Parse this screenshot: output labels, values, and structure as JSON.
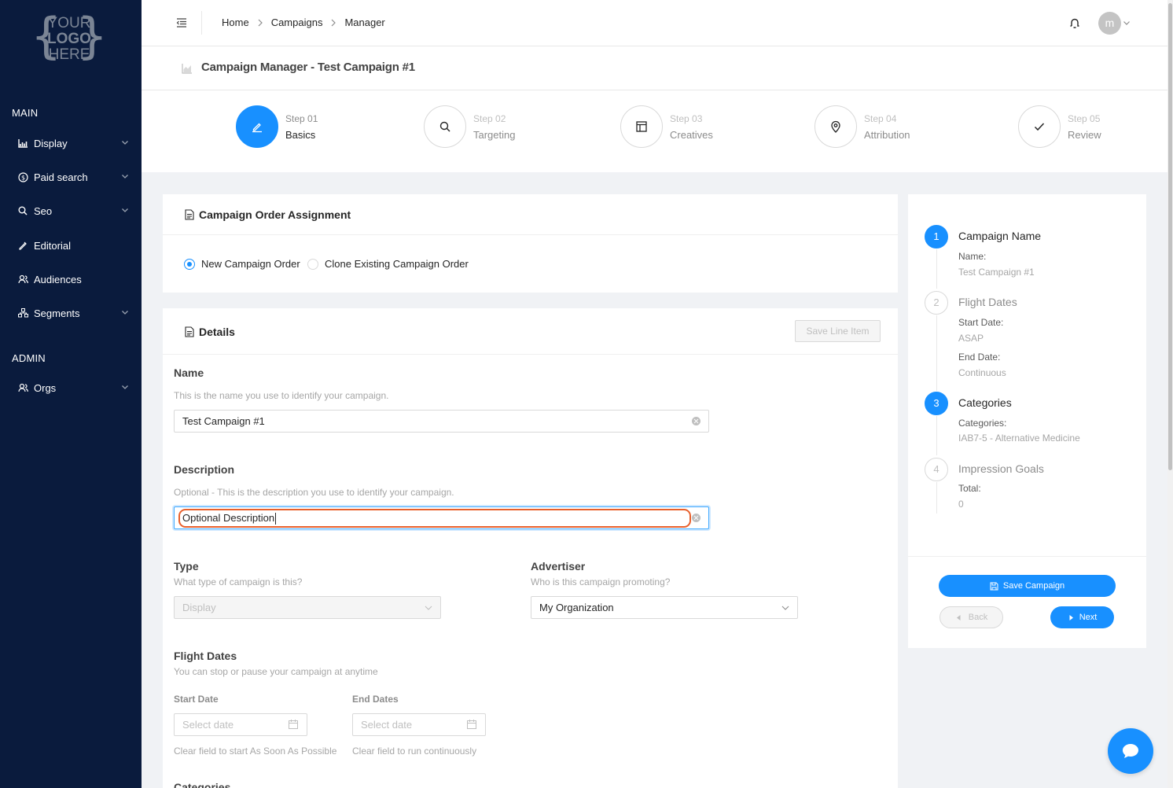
{
  "logo": {
    "line1": "YOUR",
    "line2": "LOGO",
    "line3": "HERE"
  },
  "sidebar": {
    "main_title": "MAIN",
    "admin_title": "ADMIN",
    "items": [
      {
        "label": "Display",
        "icon": "chart-icon",
        "has_children": true
      },
      {
        "label": "Paid search",
        "icon": "dollar-icon",
        "has_children": true
      },
      {
        "label": "Seo",
        "icon": "search-icon",
        "has_children": true
      },
      {
        "label": "Editorial",
        "icon": "pen-icon",
        "has_children": false
      },
      {
        "label": "Audiences",
        "icon": "users-icon",
        "has_children": false
      },
      {
        "label": "Segments",
        "icon": "cluster-icon",
        "has_children": true
      }
    ],
    "admin_items": [
      {
        "label": "Orgs",
        "icon": "users-icon",
        "has_children": true
      }
    ]
  },
  "header": {
    "breadcrumb": [
      "Home",
      "Campaigns",
      "Manager"
    ],
    "avatar_initial": "m"
  },
  "page_title": "Campaign Manager - Test Campaign #1",
  "steps": [
    {
      "num": "Step 01",
      "label": "Basics",
      "icon": "edit-icon",
      "active": true
    },
    {
      "num": "Step 02",
      "label": "Targeting",
      "icon": "search-icon",
      "active": false
    },
    {
      "num": "Step 03",
      "label": "Creatives",
      "icon": "layout-icon",
      "active": false
    },
    {
      "num": "Step 04",
      "label": "Attribution",
      "icon": "location-icon",
      "active": false
    },
    {
      "num": "Step 05",
      "label": "Review",
      "icon": "check-icon",
      "active": false
    }
  ],
  "order_card": {
    "title": "Campaign Order Assignment",
    "options": [
      "New Campaign Order",
      "Clone Existing Campaign Order"
    ],
    "selected": "New Campaign Order"
  },
  "details": {
    "title": "Details",
    "save_line_item": "Save Line Item",
    "name": {
      "label": "Name",
      "hint": "This is the name you use to identify your campaign.",
      "value": "Test Campaign #1"
    },
    "description": {
      "label": "Description",
      "hint": "Optional - This is the description you use to identify your campaign.",
      "value": "Optional Description"
    },
    "type": {
      "label": "Type",
      "hint": "What type of campaign is this?",
      "value": "Display"
    },
    "advertiser": {
      "label": "Advertiser",
      "hint": "Who is this campaign promoting?",
      "value": "My Organization"
    },
    "flight": {
      "label": "Flight Dates",
      "hint": "You can stop or pause your campaign at anytime",
      "start_label": "Start Date",
      "end_label": "End Dates",
      "start_placeholder": "Select date",
      "end_placeholder": "Select date",
      "start_help": "Clear field to start As Soon As Possible",
      "end_help": "Clear field to run continuously"
    },
    "next_section": "Categories"
  },
  "summary": {
    "items": [
      {
        "n": "1",
        "title": "Campaign Name",
        "active": true,
        "fields": [
          {
            "k": "Name:",
            "v": "Test Campaign #1"
          }
        ]
      },
      {
        "n": "2",
        "title": "Flight Dates",
        "active": false,
        "fields": [
          {
            "k": "Start Date:",
            "v": "ASAP"
          },
          {
            "k": "End Date:",
            "v": "Continuous"
          }
        ]
      },
      {
        "n": "3",
        "title": "Categories",
        "active": true,
        "fields": [
          {
            "k": "Categories:",
            "v": "IAB7-5 - Alternative Medicine"
          }
        ]
      },
      {
        "n": "4",
        "title": "Impression Goals",
        "active": false,
        "fields": [
          {
            "k": "Total:",
            "v": "0"
          }
        ]
      }
    ],
    "save_campaign": "Save Campaign",
    "back": "Back",
    "next": "Next"
  },
  "colors": {
    "primary": "#1890ff",
    "sidebar": "#0a1b3d",
    "highlight": "#e8602c"
  }
}
